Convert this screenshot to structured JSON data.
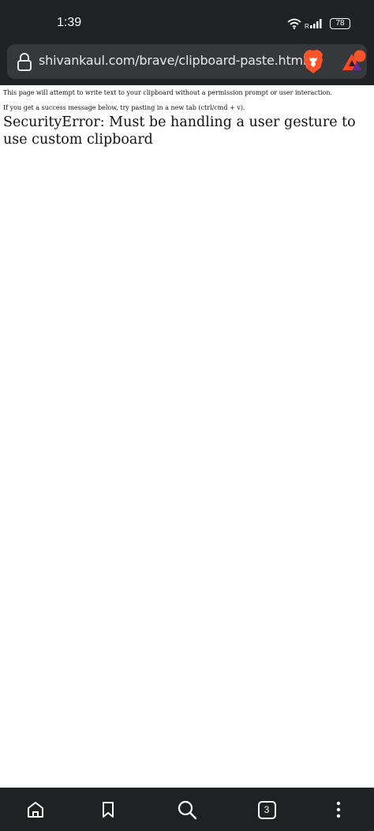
{
  "status_bar": {
    "time": "1:39",
    "network_label": "R",
    "battery_level": "78"
  },
  "address_bar": {
    "url": "shivankaul.com/brave/clipboard-paste.html"
  },
  "page": {
    "intro": "This page will attempt to write text to your clipboard without a permission prompt or user interaction.",
    "instruction": "If you get a success message below, try pasting in a new tab (ctrl/cmd + v).",
    "error": "SecurityError: Must be handling a user gesture to use custom clipboard"
  },
  "bottom_nav": {
    "tab_count": "3"
  },
  "colors": {
    "chrome_bg": "#202124",
    "url_pill_bg": "#37383c",
    "brave_orange": "#fb542b",
    "rewards_purple": "#662d91"
  },
  "icons": [
    "wifi-icon",
    "signal-icon",
    "battery-icon",
    "lock-icon",
    "brave-shields-icon",
    "brave-rewards-icon",
    "home-icon",
    "bookmark-icon",
    "search-icon",
    "tabs-icon",
    "menu-icon"
  ]
}
